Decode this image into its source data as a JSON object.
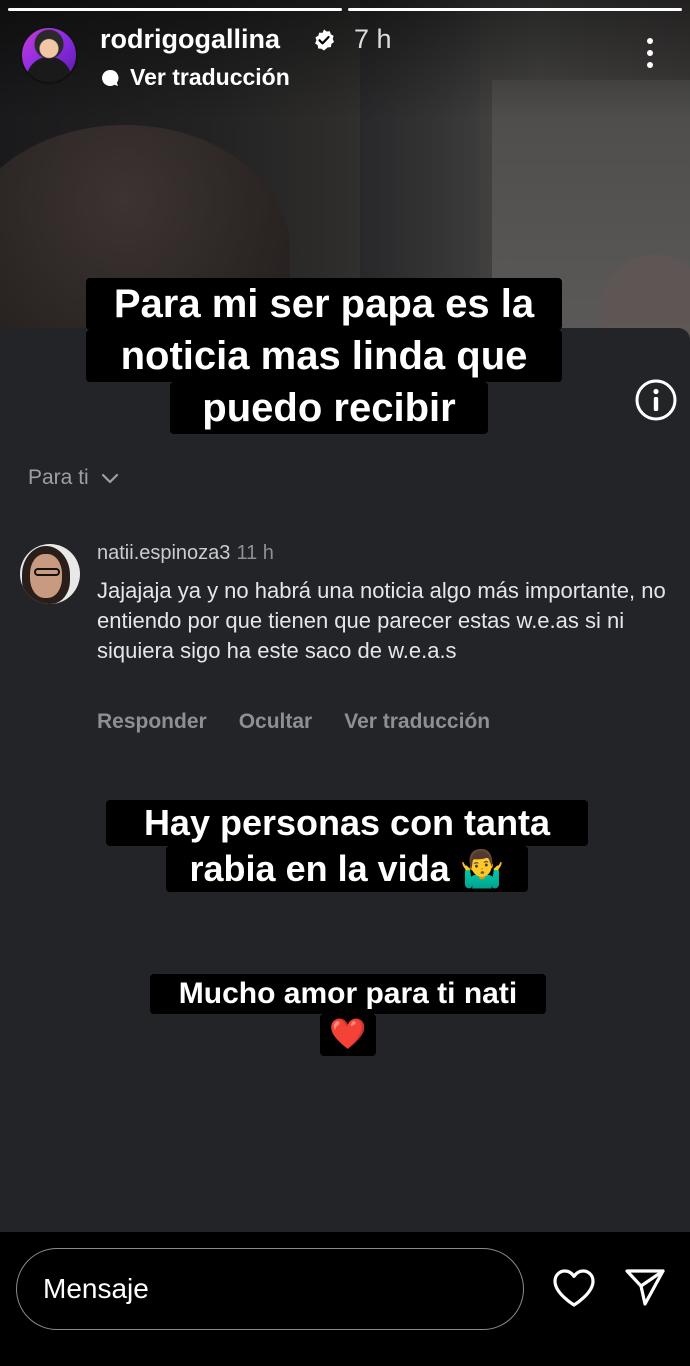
{
  "story": {
    "username": "rodrigogallina",
    "time_ago": "7 h",
    "translate_label": "Ver traducción",
    "progress": {
      "segments": 2,
      "active_index": 1
    },
    "captions": {
      "top": [
        "Para mi ser papa es la",
        "noticia mas linda que",
        "puedo recibir"
      ],
      "middle": [
        "Hay personas con tanta",
        "rabia en la vida 🤷‍♂️"
      ],
      "bottom": [
        "Mucho amor para ti nati",
        "❤️"
      ]
    }
  },
  "comment_screenshot": {
    "filter_label": "Para ti",
    "comment": {
      "username": "natii.espinoza3",
      "time_ago": "11 h",
      "text": "Jajajaja ya y no habrá una noticia algo más importante, no entiendo por que tienen que parecer estas w.e.as si ni siquiera sigo ha este saco de w.e.a.s",
      "actions": {
        "reply": "Responder",
        "hide": "Ocultar",
        "translate": "Ver traducción"
      }
    }
  },
  "bottom_bar": {
    "message_placeholder": "Mensaje"
  },
  "icons": {
    "verified": "verified-badge-icon",
    "translate": "translate-icon",
    "more": "more-options-icon",
    "info": "info-icon",
    "chevron": "chevron-down-icon",
    "like": "heart-icon",
    "send": "send-icon"
  }
}
